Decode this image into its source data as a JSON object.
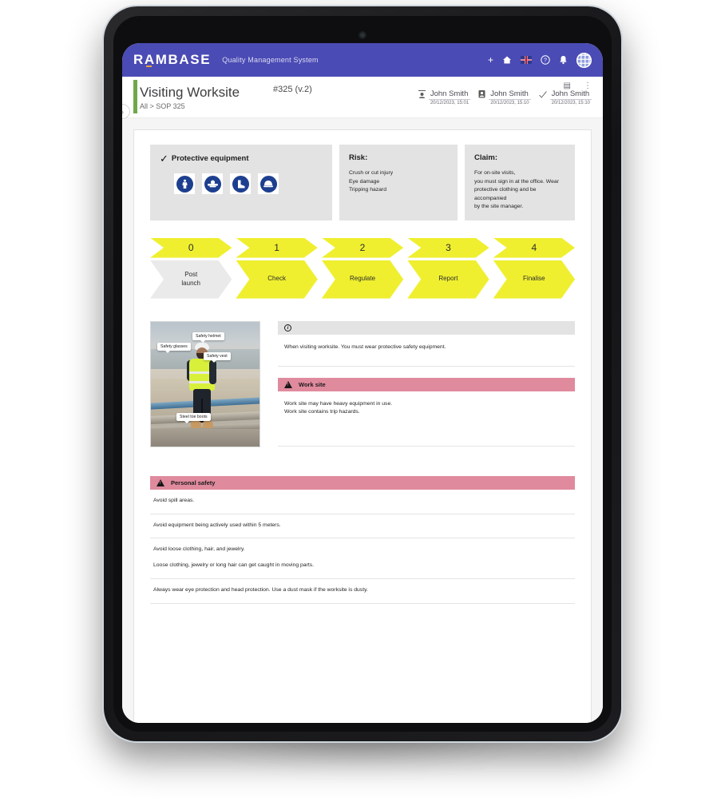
{
  "app": {
    "brand": "RAMBASE",
    "subtitle": "Quality Management System",
    "icons": {
      "plus": "+",
      "home": "⌂",
      "flag": "uk-flag-icon",
      "help": "?",
      "bell": "🔔",
      "avatar": "globe-avatar-icon"
    }
  },
  "header": {
    "title": "Visiting Worksite",
    "doc_id": "#325 (v.2)",
    "breadcrumb": "All > SOP 325",
    "toggle": "›",
    "signatures": [
      {
        "icon": "person-icon",
        "name": "John Smith",
        "date": "20/12/2023, 15:01"
      },
      {
        "icon": "badge-icon",
        "name": "John Smith",
        "date": "20/12/2023, 15:10"
      },
      {
        "icon": "check-icon",
        "name": "John Smith",
        "date": "20/12/2023, 15:10"
      }
    ],
    "actions": {
      "notes": "▤",
      "more": "⋮"
    }
  },
  "ppe_panel": {
    "check": "✓",
    "title": "Protective equipment",
    "icons": [
      "protective-clothing-icon",
      "eye-protection-icon",
      "safety-boots-icon",
      "head-protection-icon"
    ]
  },
  "risk_panel": {
    "title": "Risk:",
    "body": "Crush or cut injury\nEye damage\nTripping hazard"
  },
  "claim_panel": {
    "title": "Claim:",
    "body": "For on-site visits,\nyou must sign in at the office. Wear\nprotective clothing and be accompanied\nby the site manager."
  },
  "flow": {
    "numbers": [
      "0",
      "1",
      "2",
      "3",
      "4"
    ],
    "labels": [
      "Post\nlaunch",
      "Check",
      "Regulate",
      "Report",
      "Finalise"
    ],
    "active_color": "#efef30",
    "inactive_color": "#eaeaea"
  },
  "photo": {
    "callouts": [
      "Safety glasses",
      "Safety helmet",
      "Safety vest",
      "Steel toe boots"
    ]
  },
  "notes": {
    "info": {
      "icon": "info-icon",
      "title": "",
      "body": "When visiting worksite. You must wear protective safety equipment."
    },
    "worksite": {
      "icon": "warning-icon",
      "title": "Work site",
      "body": "Work site may have heavy equipment in use.\nWork site contains trip hazards."
    }
  },
  "personal_safety": {
    "icon": "warning-icon",
    "title": "Personal safety",
    "items": [
      [
        "Avoid spill areas."
      ],
      [
        "Avoid equipment being actively used within 5 meters."
      ],
      [
        "Avoid loose clothing, hair, and jewelry.",
        "Loose clothing, jewelry or long hair can get caught in moving parts."
      ],
      [
        "Always wear eye protection and head protection. Use a dust mask if the worksite is dusty."
      ]
    ]
  },
  "colors": {
    "brand_bar": "#4b4bb5",
    "accent_green": "#6fa84b",
    "warning_pink": "#e08a9e",
    "panel_grey": "#e3e3e3"
  }
}
